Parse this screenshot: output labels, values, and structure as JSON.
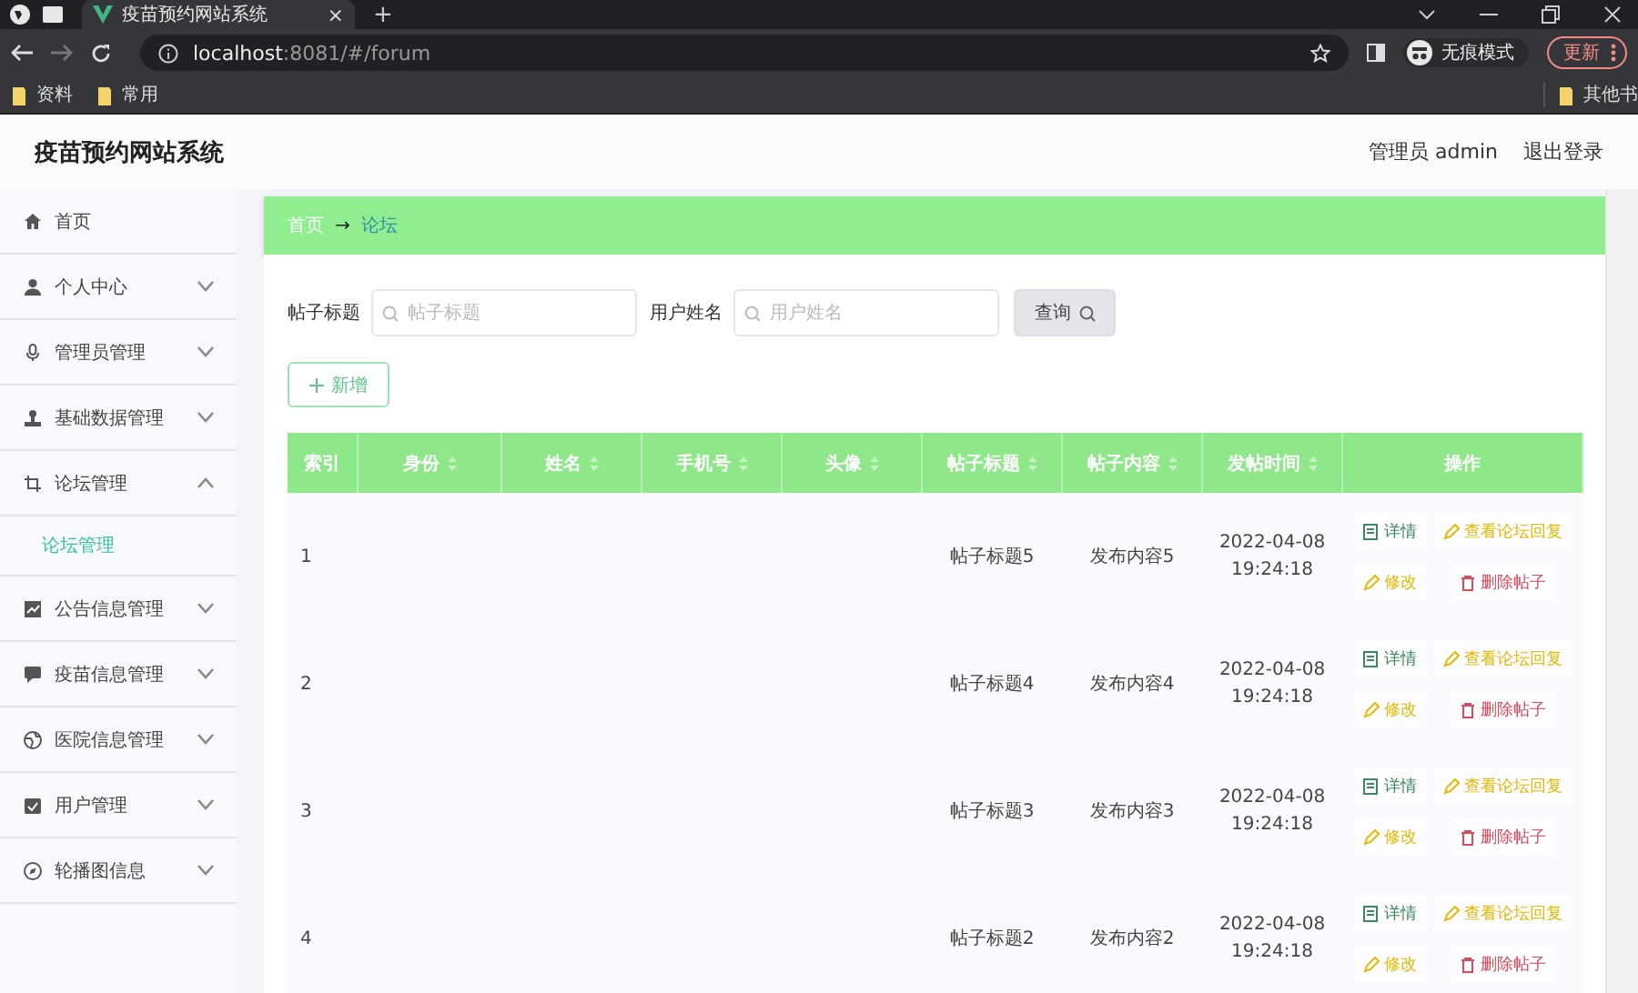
{
  "browser": {
    "tabs": [
      {
        "title": "疫苗预约网站系统",
        "selected": true
      }
    ],
    "close_tab": "×",
    "new_tab": "+",
    "url_host": "localhost",
    "url_path": ":8081/#/forum",
    "profile": "无痕模式",
    "update": "更新",
    "bookmarks": [
      {
        "label": "资料"
      },
      {
        "label": "常用"
      }
    ],
    "other_bookmarks": "其他书"
  },
  "header": {
    "title": "疫苗预约网站系统",
    "user": "管理员 admin",
    "logout": "退出登录"
  },
  "sidebar": {
    "items": [
      {
        "label": "首页",
        "kind": "link"
      },
      {
        "label": "个人中心",
        "kind": "menu",
        "expanded": false
      },
      {
        "label": "管理员管理",
        "kind": "menu",
        "expanded": false
      },
      {
        "label": "基础数据管理",
        "kind": "menu",
        "expanded": false
      },
      {
        "label": "论坛管理",
        "kind": "menu",
        "expanded": true,
        "children": [
          {
            "label": "论坛管理",
            "selected": true
          }
        ]
      },
      {
        "label": "公告信息管理",
        "kind": "menu",
        "expanded": false
      },
      {
        "label": "疫苗信息管理",
        "kind": "menu",
        "expanded": false
      },
      {
        "label": "医院信息管理",
        "kind": "menu",
        "expanded": false
      },
      {
        "label": "用户管理",
        "kind": "menu",
        "expanded": false
      },
      {
        "label": "轮播图信息",
        "kind": "menu",
        "expanded": false
      }
    ]
  },
  "breadcrumb": [
    {
      "label": "首页",
      "current": false
    },
    {
      "label": "论坛",
      "current": true
    }
  ],
  "breadcrumb_separator": "→",
  "search": {
    "fields": [
      {
        "label": "帖子标题",
        "placeholder": "帖子标题"
      },
      {
        "label": "用户姓名",
        "placeholder": "用户姓名"
      }
    ],
    "button": "查询"
  },
  "add_button": "新增",
  "table": {
    "columns": [
      {
        "label": "索引",
        "sortable": false
      },
      {
        "label": "身份",
        "sortable": true
      },
      {
        "label": "姓名",
        "sortable": true
      },
      {
        "label": "手机号",
        "sortable": true
      },
      {
        "label": "头像",
        "sortable": true
      },
      {
        "label": "帖子标题",
        "sortable": true
      },
      {
        "label": "帖子内容",
        "sortable": true
      },
      {
        "label": "发帖时间",
        "sortable": true
      },
      {
        "label": "操作",
        "sortable": false
      }
    ],
    "rows": [
      {
        "index": "1",
        "title": "帖子标题5",
        "content": "发布内容5",
        "time": "2022-04-08 19:24:18",
        "actions": [
          {
            "kind": "detail",
            "label": "详情"
          },
          {
            "kind": "reply",
            "label": "查看论坛回复"
          },
          {
            "kind": "edit",
            "label": "修改"
          },
          {
            "kind": "delete",
            "label": "删除帖子"
          }
        ]
      },
      {
        "index": "2",
        "title": "帖子标题4",
        "content": "发布内容4",
        "time": "2022-04-08 19:24:18",
        "actions": [
          {
            "kind": "detail",
            "label": "详情"
          },
          {
            "kind": "reply",
            "label": "查看论坛回复"
          },
          {
            "kind": "edit",
            "label": "修改"
          },
          {
            "kind": "delete",
            "label": "删除帖子"
          }
        ]
      },
      {
        "index": "3",
        "title": "帖子标题3",
        "content": "发布内容3",
        "time": "2022-04-08 19:24:18",
        "actions": [
          {
            "kind": "detail",
            "label": "详情"
          },
          {
            "kind": "reply",
            "label": "查看论坛回复"
          },
          {
            "kind": "edit",
            "label": "修改"
          },
          {
            "kind": "delete",
            "label": "删除帖子"
          }
        ]
      },
      {
        "index": "4",
        "title": "帖子标题2",
        "content": "发布内容2",
        "time": "2022-04-08 19:24:18",
        "actions": [
          {
            "kind": "detail",
            "label": "详情"
          },
          {
            "kind": "reply",
            "label": "查看论坛回复"
          },
          {
            "kind": "edit",
            "label": "修改"
          },
          {
            "kind": "delete",
            "label": "删除帖子"
          }
        ]
      }
    ]
  }
}
